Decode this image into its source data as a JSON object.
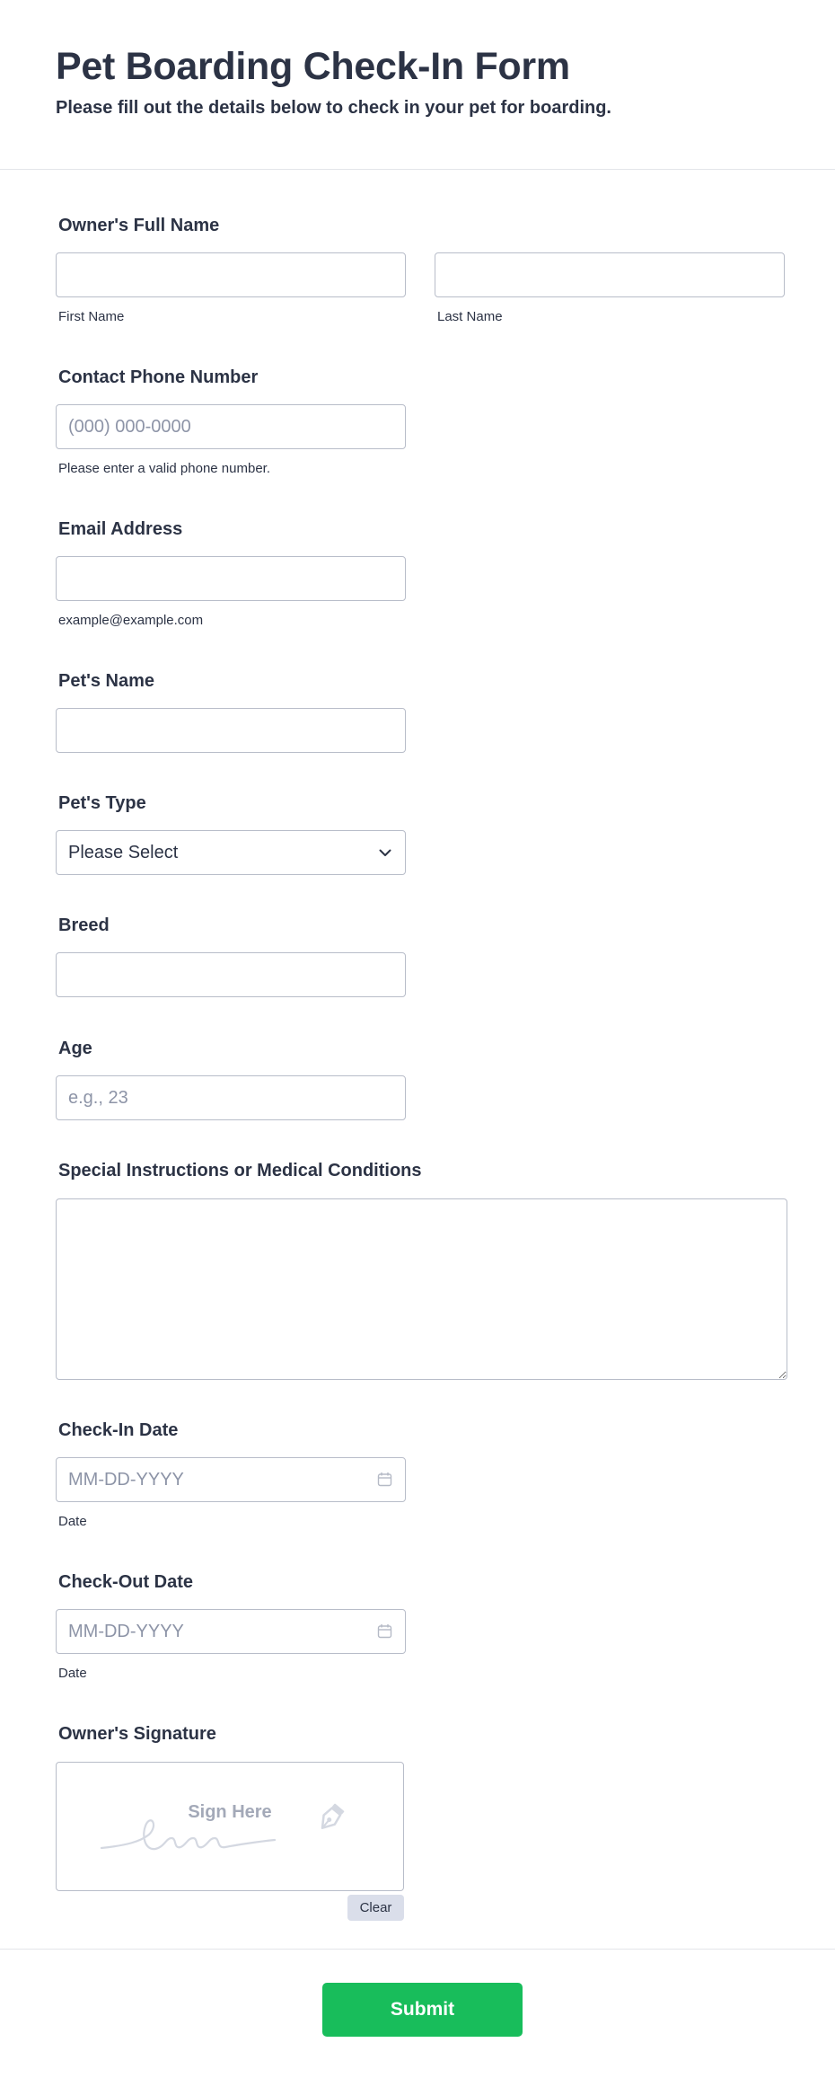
{
  "header": {
    "title": "Pet Boarding Check-In Form",
    "subtitle": "Please fill out the details below to check in your pet for boarding."
  },
  "owner_name": {
    "label": "Owner's Full Name",
    "first_value": "",
    "first_sublabel": "First Name",
    "last_value": "",
    "last_sublabel": "Last Name"
  },
  "phone": {
    "label": "Contact Phone Number",
    "placeholder": "(000) 000-0000",
    "value": "",
    "sublabel": "Please enter a valid phone number."
  },
  "email": {
    "label": "Email Address",
    "value": "",
    "sublabel": "example@example.com"
  },
  "pet_name": {
    "label": "Pet's Name",
    "value": ""
  },
  "pet_type": {
    "label": "Pet's Type",
    "selected": "Please Select",
    "icon": "chevron-down-icon"
  },
  "breed": {
    "label": "Breed",
    "value": ""
  },
  "age": {
    "label": "Age",
    "placeholder": "e.g., 23",
    "value": ""
  },
  "instructions": {
    "label": "Special Instructions or Medical Conditions",
    "value": ""
  },
  "check_in": {
    "label": "Check-In Date",
    "placeholder": "MM-DD-YYYY",
    "sublabel": "Date",
    "icon": "calendar-icon"
  },
  "check_out": {
    "label": "Check-Out Date",
    "placeholder": "MM-DD-YYYY",
    "sublabel": "Date",
    "icon": "calendar-icon"
  },
  "signature": {
    "label": "Owner's Signature",
    "pad_text": "Sign Here",
    "clear_label": "Clear",
    "icon": "pen-nib-icon"
  },
  "submit": {
    "label": "Submit"
  },
  "colors": {
    "text": "#2c3345",
    "border": "#b8bdc9",
    "placeholder": "#8d94a7",
    "submit": "#18bd5b",
    "clear_bg": "#dadeea"
  }
}
